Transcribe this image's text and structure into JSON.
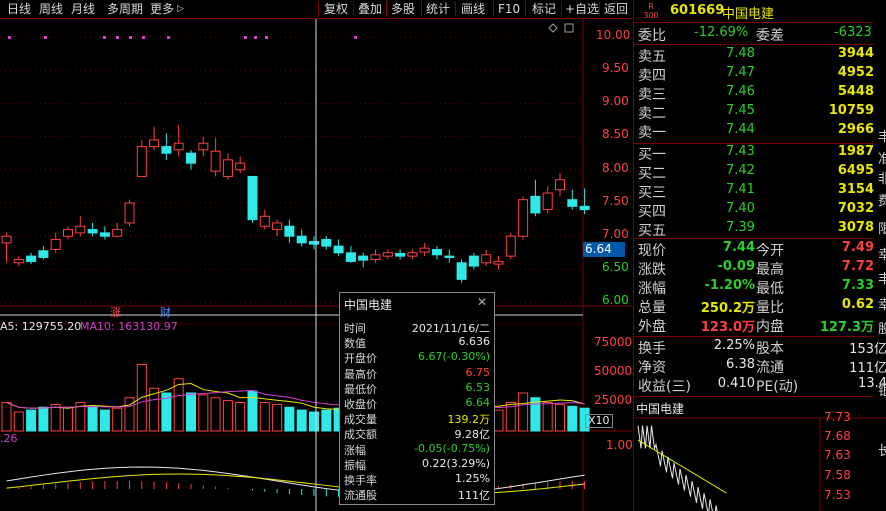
{
  "toolbar": {
    "left": [
      "日线",
      "周线",
      "月线",
      "多周期",
      "更多"
    ],
    "more_arrow": "▷",
    "right": [
      "复权",
      "叠加",
      "多股",
      "统计",
      "画线",
      "F10",
      "标记",
      "+自选",
      "返回"
    ]
  },
  "stock": {
    "code": "601669",
    "name": "中国电建",
    "badge_top": "R",
    "badge_bottom": "300"
  },
  "price_axis": [
    "10.00",
    "9.50",
    "9.00",
    "8.50",
    "8.00",
    "7.50",
    "7.00",
    "6.50",
    "6.00"
  ],
  "crosshair_price": "6.64",
  "annotations": {
    "zhang": "涨",
    "cai": "财"
  },
  "volume": {
    "ma5_label": "A5: 129755.20",
    "ma10_label": "MA10: 163130.97",
    "axis": [
      "75000",
      "50000",
      "25000"
    ],
    "unit": "X10"
  },
  "macd": {
    "label": ".26",
    "axis": [
      "1.00"
    ]
  },
  "tooltip": {
    "title": "中国电建",
    "close_glyph": "✕",
    "rows": [
      {
        "k": "时间",
        "v": "2021/11/16/二",
        "c": "#e8e8e8"
      },
      {
        "k": "数值",
        "v": "6.636",
        "c": "#e8e8e8"
      },
      {
        "k": "开盘价",
        "v": "6.67(-0.30%)",
        "c": "#2ad02a"
      },
      {
        "k": "最高价",
        "v": "6.75",
        "c": "#ff4040"
      },
      {
        "k": "最低价",
        "v": "6.53",
        "c": "#2ad02a"
      },
      {
        "k": "收盘价",
        "v": "6.64",
        "c": "#2ad02a"
      },
      {
        "k": "成交量",
        "v": "139.2万",
        "c": "#e8e800"
      },
      {
        "k": "成交额",
        "v": "9.28亿",
        "c": "#e8e8e8"
      },
      {
        "k": "涨幅",
        "v": "-0.05(-0.75%)",
        "c": "#2ad02a"
      },
      {
        "k": "振幅",
        "v": "0.22(3.29%)",
        "c": "#e8e8e8"
      },
      {
        "k": "换手率",
        "v": "1.25%",
        "c": "#e8e8e8"
      },
      {
        "k": "流通股",
        "v": "111亿",
        "c": "#e8e8e8"
      }
    ]
  },
  "quote": {
    "weibi": {
      "label": "委比",
      "value": "-12.69%",
      "label2": "委差",
      "value2": "-6323"
    },
    "sells": [
      {
        "label": "卖五",
        "price": "7.48",
        "vol": "3944"
      },
      {
        "label": "卖四",
        "price": "7.47",
        "vol": "4952"
      },
      {
        "label": "卖三",
        "price": "7.46",
        "vol": "5448"
      },
      {
        "label": "卖二",
        "price": "7.45",
        "vol": "10759"
      },
      {
        "label": "卖一",
        "price": "7.44",
        "vol": "2966"
      }
    ],
    "buys": [
      {
        "label": "买一",
        "price": "7.43",
        "vol": "1987"
      },
      {
        "label": "买二",
        "price": "7.42",
        "vol": "6495"
      },
      {
        "label": "买三",
        "price": "7.41",
        "vol": "3154"
      },
      {
        "label": "买四",
        "price": "7.40",
        "vol": "7032"
      },
      {
        "label": "买五",
        "price": "7.39",
        "vol": "3078"
      }
    ],
    "stats": [
      {
        "l1": "现价",
        "v1": "7.44",
        "c1": "#2ad02a",
        "l2": "今开",
        "v2": "7.49",
        "c2": "#ff4040"
      },
      {
        "l1": "涨跌",
        "v1": "-0.09",
        "c1": "#2ad02a",
        "l2": "最高",
        "v2": "7.72",
        "c2": "#ff4040"
      },
      {
        "l1": "涨幅",
        "v1": "-1.20%",
        "c1": "#2ad02a",
        "l2": "最低",
        "v2": "7.33",
        "c2": "#2ad02a"
      },
      {
        "l1": "总量",
        "v1": "250.2万",
        "c1": "#e8e800",
        "l2": "量比",
        "v2": "0.62",
        "c2": "#e8e800"
      },
      {
        "l1": "外盘",
        "v1": "123.0万",
        "c1": "#ff4040",
        "l2": "内盘",
        "v2": "127.3万",
        "c2": "#2ad02a"
      }
    ],
    "stats2": [
      {
        "l1": "换手",
        "v1": "2.25%",
        "l2": "股本",
        "v2": "153亿"
      },
      {
        "l1": "净资",
        "v1": "6.38",
        "l2": "流通",
        "v2": "111亿"
      },
      {
        "l1": "收益(三)",
        "v1": "0.410",
        "l2": "PE(动)",
        "v2": "13.4"
      }
    ]
  },
  "mini_chart": {
    "title": "中国电建",
    "axis": [
      "7.73",
      "7.68",
      "7.63",
      "7.58",
      "7.53"
    ]
  },
  "side_fragments": [
    "丰",
    "准",
    "非",
    "费",
    "限",
    "幸",
    "丰",
    "幸",
    "股",
    "银",
    "长"
  ]
}
